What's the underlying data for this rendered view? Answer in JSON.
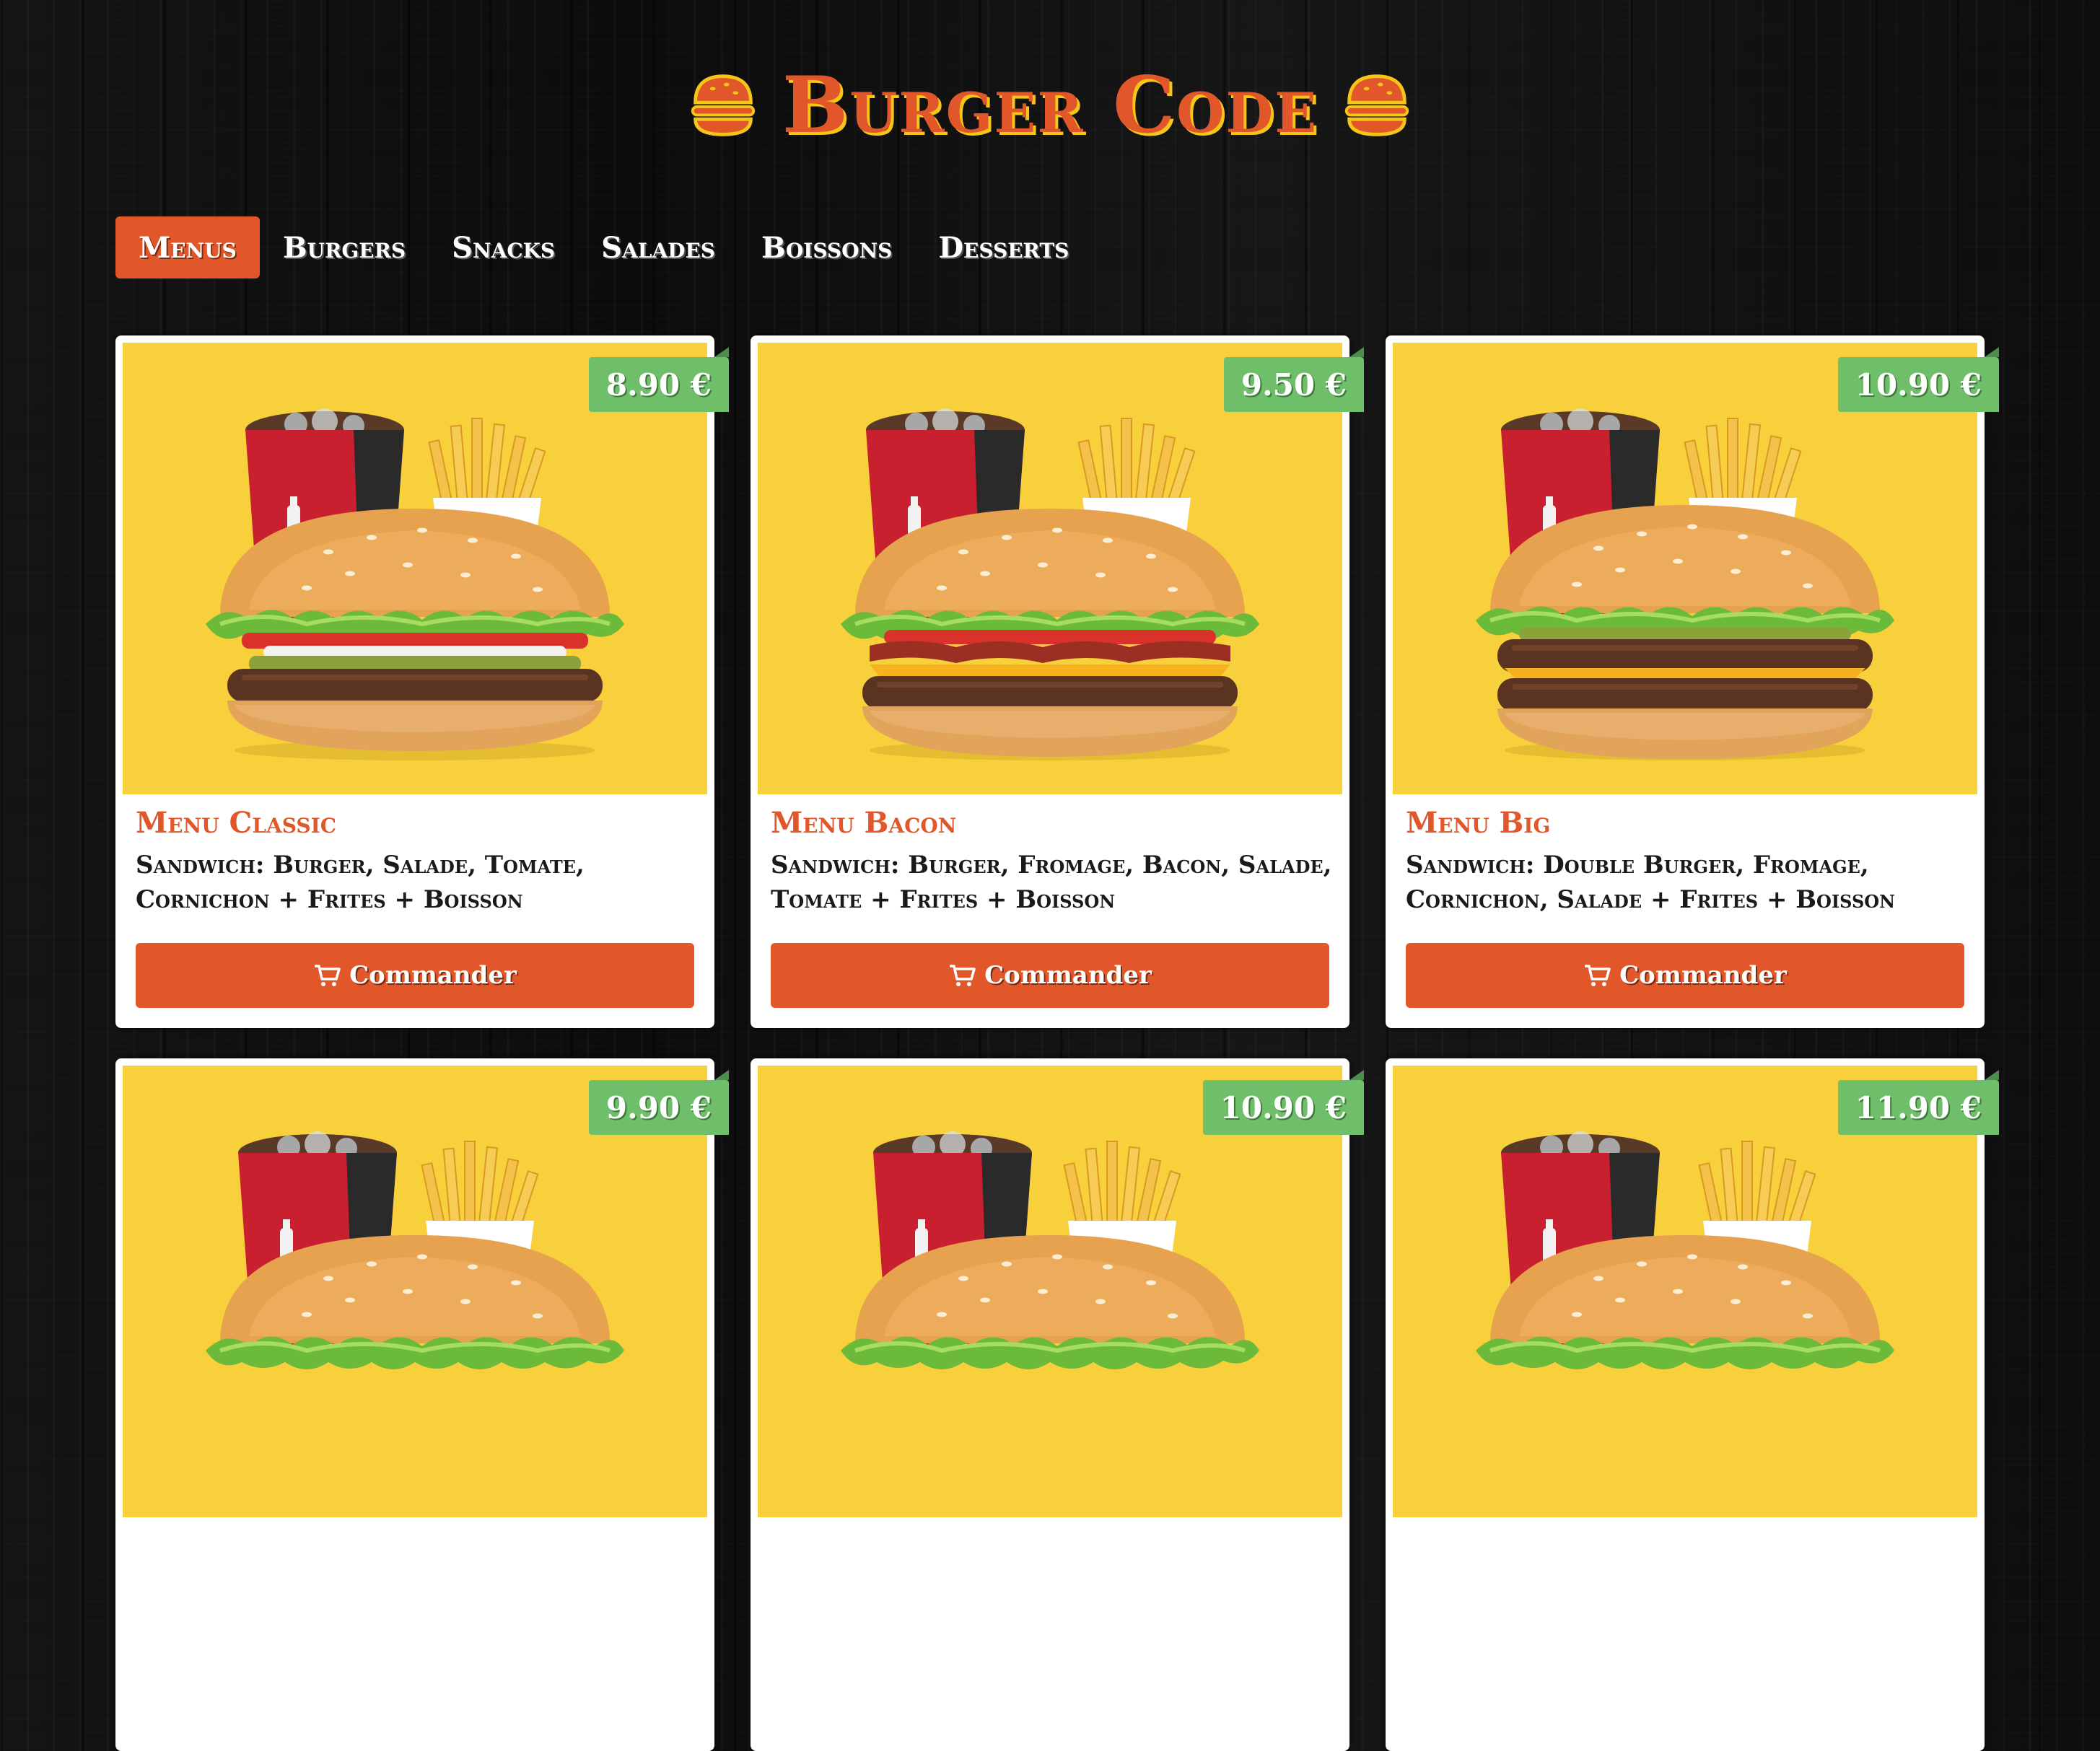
{
  "header": {
    "title": "Burger Code"
  },
  "nav": {
    "tabs": [
      {
        "label": "Menus",
        "active": true
      },
      {
        "label": "Burgers",
        "active": false
      },
      {
        "label": "Snacks",
        "active": false
      },
      {
        "label": "Salades",
        "active": false
      },
      {
        "label": "Boissons",
        "active": false
      },
      {
        "label": "Desserts",
        "active": false
      }
    ]
  },
  "products": [
    {
      "name": "Menu Classic",
      "price": "8.90 €",
      "description": "Sandwich: Burger, Salade, Tomate, Cornichon + Frites + Boisson",
      "button": "Commander",
      "burger": "classic"
    },
    {
      "name": "Menu Bacon",
      "price": "9.50 €",
      "description": "Sandwich: Burger, Fromage, Bacon, Salade, Tomate + Frites + Boisson",
      "button": "Commander",
      "burger": "bacon"
    },
    {
      "name": "Menu Big",
      "price": "10.90 €",
      "description": "Sandwich: Double Burger, Fromage, Cornichon, Salade + Frites + Boisson",
      "button": "Commander",
      "burger": "double"
    },
    {
      "name": "",
      "price": "9.90 €",
      "description": "",
      "button": "",
      "burger": "classic"
    },
    {
      "name": "",
      "price": "10.90 €",
      "description": "",
      "button": "",
      "burger": "classic"
    },
    {
      "name": "",
      "price": "11.90 €",
      "description": "",
      "button": "",
      "burger": "classic"
    }
  ],
  "colors": {
    "brand": "#e1572a",
    "title_shadow": "#f5c518",
    "card_background": "#f8d03c",
    "price_badge": "#6fbe6a",
    "page_background": "#101010"
  },
  "icons": {
    "logo": "burger-icon",
    "order": "cart-icon"
  }
}
